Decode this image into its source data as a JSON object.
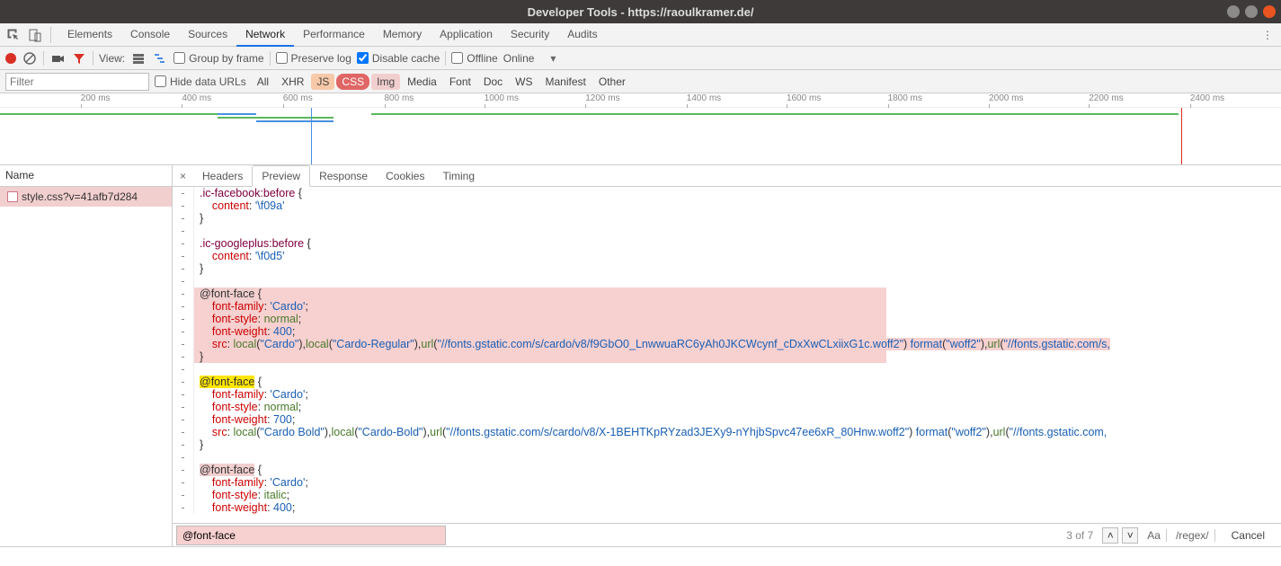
{
  "window": {
    "title": "Developer Tools - https://raoulkramer.de/"
  },
  "main_tabs": {
    "items": [
      "Elements",
      "Console",
      "Sources",
      "Network",
      "Performance",
      "Memory",
      "Application",
      "Security",
      "Audits"
    ],
    "active": "Network"
  },
  "net_toolbar": {
    "view_label": "View:",
    "group_by_frame": "Group by frame",
    "preserve_log": "Preserve log",
    "disable_cache": "Disable cache",
    "disable_cache_checked": true,
    "offline": "Offline",
    "online": "Online"
  },
  "filter_bar": {
    "placeholder": "Filter",
    "hide_data_urls": "Hide data URLs",
    "types": [
      "All",
      "XHR",
      "JS",
      "CSS",
      "Img",
      "Media",
      "Font",
      "Doc",
      "WS",
      "Manifest",
      "Other"
    ]
  },
  "timeline_ticks": [
    "200 ms",
    "400 ms",
    "600 ms",
    "800 ms",
    "1000 ms",
    "1200 ms",
    "1400 ms",
    "1600 ms",
    "1800 ms",
    "2000 ms",
    "2200 ms",
    "2400 ms"
  ],
  "left_panel": {
    "header": "Name",
    "file": "style.css?v=41afb7d284"
  },
  "sub_tabs": {
    "items": [
      "Headers",
      "Preview",
      "Response",
      "Cookies",
      "Timing"
    ],
    "active": "Preview"
  },
  "code": {
    "fb_sel": ".ic-facebook:before",
    "fb_open": " {",
    "content_prop": "content",
    "colon": ": ",
    "fb_val": "'\\f09a'",
    "close_brace": "}",
    "gp_sel": ".ic-googleplus:before",
    "gp_open": " {",
    "gp_val": "'\\f0d5'",
    "fontface": "@font-face",
    "brace_open": " {",
    "family_prop": "font-family",
    "family_val": "'Cardo'",
    "style_prop": "font-style",
    "style_normal": "normal",
    "style_italic": "italic",
    "weight_prop": "font-weight",
    "weight_400": "400",
    "weight_700": "700",
    "src_prop": "src",
    "local": "local",
    "url": "url",
    "cardo": "\"Cardo\"",
    "cardo_reg": "\"Cardo-Regular\"",
    "cardo_bold": "\"Cardo Bold\"",
    "cardo_bold2": "\"Cardo-Bold\"",
    "url1": "\"//fonts.gstatic.com/s/cardo/v8/f9GbO0_LnwwuaRC6yAh0JKCWcynf_cDxXwCLxiixG1c.woff2\"",
    "url2": "\"//fonts.gstatic.com/s/cardo/v8/X-1BEHTKpRYzad3JEXy9-nYhjbSpvc47ee6xR_80Hnw.woff2\"",
    "url_tail": "\"//fonts.gstatic.com/s,",
    "url_tail2": "\"//fonts.gstatic.com,",
    "format": "format",
    "woff2": "\"woff2\"",
    "semi": ";",
    "comma": ",",
    "paren_o": "(",
    "paren_c": ")"
  },
  "find": {
    "value": "@font-face",
    "match": "3 of 7",
    "aa": "Aa",
    "regex": "/regex/",
    "cancel": "Cancel"
  }
}
